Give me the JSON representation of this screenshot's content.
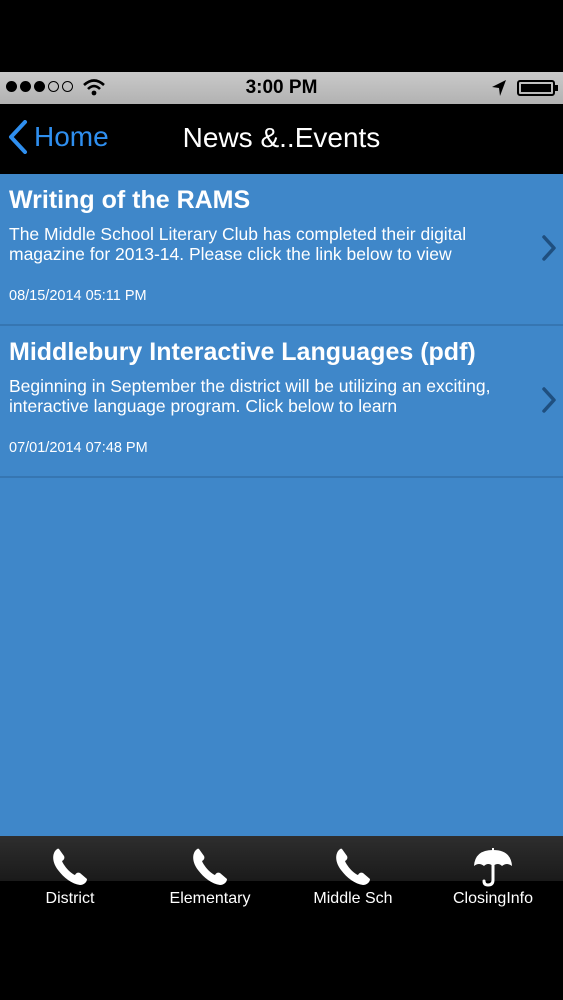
{
  "status_bar": {
    "time": "3:00 PM"
  },
  "nav": {
    "back_label": "Home",
    "title": "News &..Events"
  },
  "news": [
    {
      "title": "Writing of the RAMS",
      "body": "The Middle School Literary Club has completed their digital magazine for 2013-14. Please click the link below to view",
      "date": "08/15/2014 05:11 PM"
    },
    {
      "title": "Middlebury Interactive Languages (pdf)",
      "body": "Beginning in September the district will be utilizing an exciting, interactive language program. Click below to learn",
      "date": "07/01/2014 07:48 PM"
    }
  ],
  "tabs": [
    {
      "label": "District",
      "icon": "phone-icon"
    },
    {
      "label": "Elementary",
      "icon": "phone-icon"
    },
    {
      "label": "Middle Sch",
      "icon": "phone-icon"
    },
    {
      "label": "ClosingInfo",
      "icon": "umbrella-icon"
    }
  ],
  "colors": {
    "accent": "#2f8fef",
    "content_bg": "#3f87c9",
    "divider": "#3676b2"
  }
}
